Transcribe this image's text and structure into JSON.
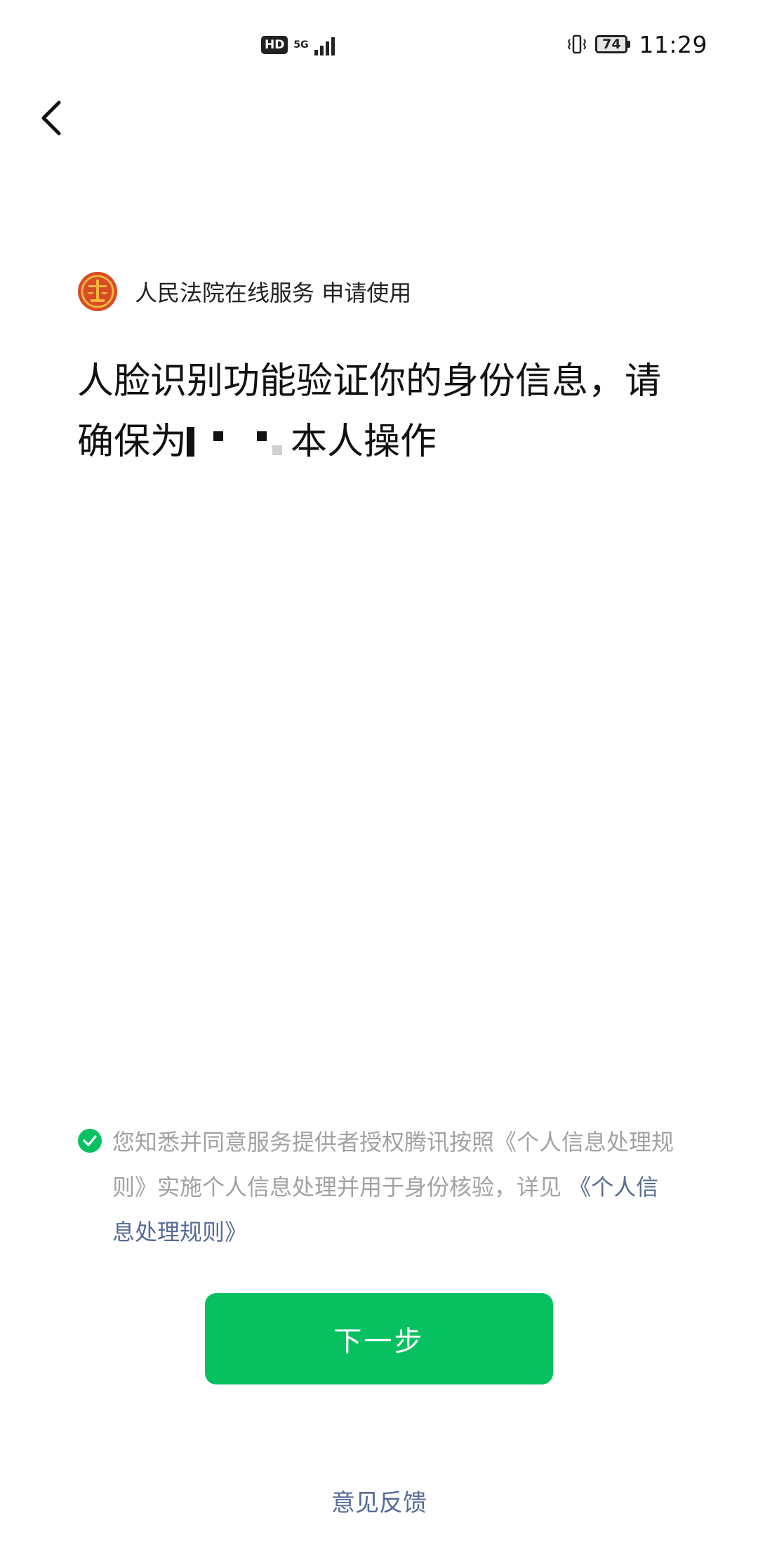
{
  "status_bar": {
    "hd": "HD",
    "network": "5G",
    "battery_level": "74",
    "time": "11:29"
  },
  "icons": {
    "back": "chevron-left-icon",
    "logo": "court-emblem-icon",
    "check": "check-circle-icon"
  },
  "colors": {
    "brand_green": "#07c160",
    "link_blue": "#576b95",
    "muted_text": "#a2a2a2",
    "logo_red": "#d94b26",
    "logo_gold": "#f1b53b"
  },
  "app": {
    "name": "人民法院在线服务",
    "request_label": "申请使用"
  },
  "headline": {
    "before_name": "人脸识别功能验证你的身份信息，请确保为",
    "after_name": "本人操作"
  },
  "consent": {
    "text_part1": "您知悉并同意服务提供者授权腾讯按照《个人信息处理规则》实施个人信息处理并用于身份核验，详见",
    "link": "《个人信息处理规则》"
  },
  "next_button": "下一步",
  "feedback": "意见反馈"
}
